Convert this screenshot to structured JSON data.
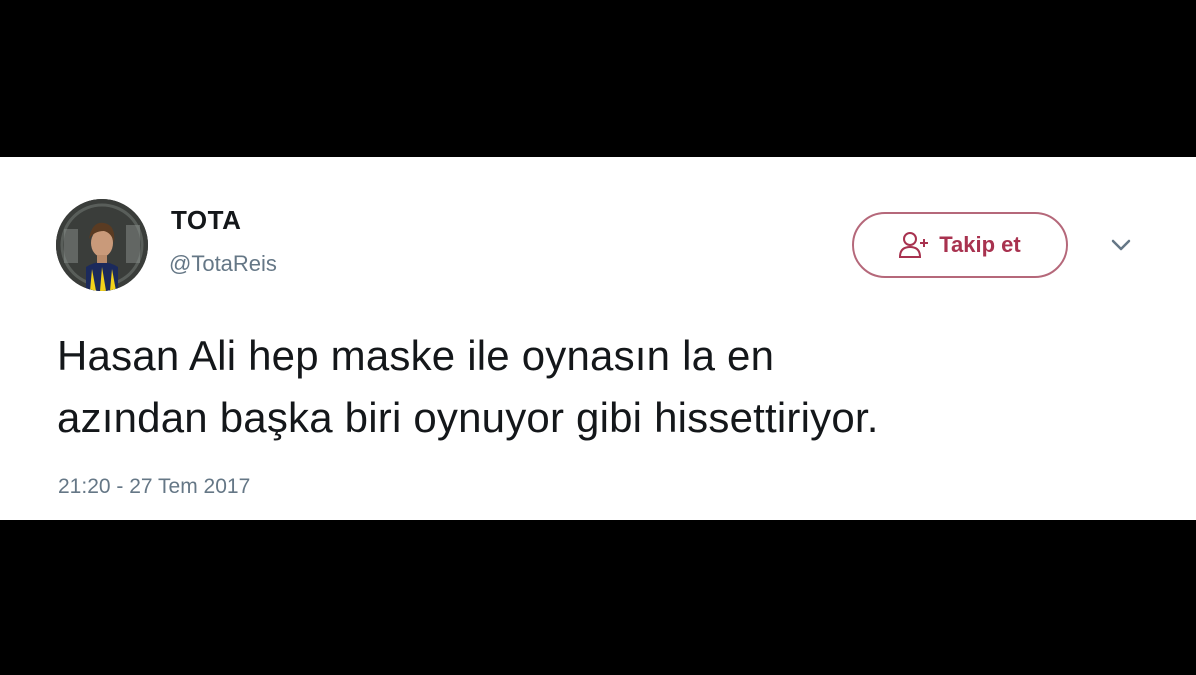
{
  "tweet": {
    "display_name": "TOTA",
    "handle": "@TotaReis",
    "follow_label": "Takip et",
    "text": "Hasan Ali hep maske ile oynasın la en\nazından başka biri oynuyor gibi hissettiriyor.",
    "timestamp": "21:20 - 27 Tem 2017"
  },
  "icons": {
    "follow": "person-add-icon",
    "menu": "chevron-down-icon",
    "avatar": "avatar-photo"
  },
  "colors": {
    "background_bars": "#000000",
    "card": "#ffffff",
    "name": "#14171a",
    "muted": "#657786",
    "follow_accent": "#a8324f"
  }
}
